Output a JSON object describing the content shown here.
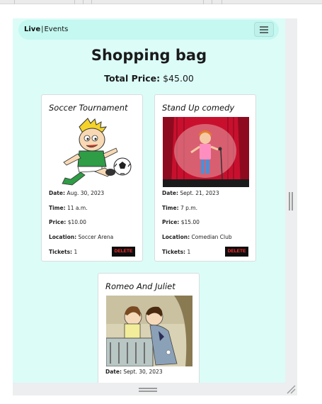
{
  "navbar": {
    "brand_bold": "Live",
    "brand_sep": "|",
    "brand_rest": "Events",
    "menu_icon": "hamburger-icon"
  },
  "page": {
    "title": "Shopping bag",
    "total_label": "Total Price:",
    "total_value": "$45.00"
  },
  "labels": {
    "date": "Date:",
    "time": "Time:",
    "price": "Price:",
    "location": "Location:",
    "tickets": "Tickets:",
    "delete": "DELETE"
  },
  "events": [
    {
      "title": "Soccer Tournament",
      "image": "cartoon-boy-kicking-soccer-ball",
      "date": "Aug. 30, 2023",
      "time": "11 a.m.",
      "price": "$10.00",
      "location": "Soccer Arena",
      "tickets": "1"
    },
    {
      "title": "Stand Up comedy",
      "image": "comedian-on-stage-with-microphone",
      "date": "Sept. 21, 2023",
      "time": "7 p.m.",
      "price": "$15.00",
      "location": "Comedian Club",
      "tickets": "1"
    },
    {
      "title": "Romeo And Juliet",
      "image": "romeo-and-juliet-balcony-cartoon",
      "date": "Sept. 30, 2023"
    }
  ],
  "colors": {
    "page_bg": "#dcfcf8",
    "navbar_bg": "#c4f8f1",
    "delete_bg": "#0e0e0e",
    "delete_text": "#ff2b2b"
  }
}
